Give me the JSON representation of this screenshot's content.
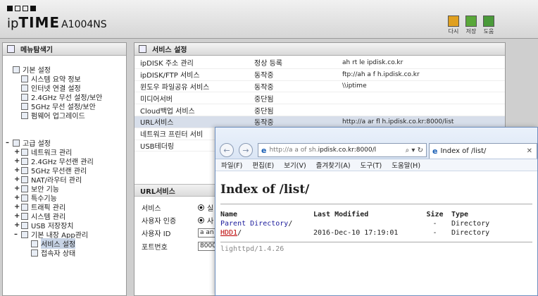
{
  "header": {
    "brand_ip": "ip",
    "brand_time": "TIME",
    "model": "A1004NS",
    "actions": [
      {
        "label": "다시",
        "color": "#e0a020"
      },
      {
        "label": "저장",
        "color": "#5aa83a"
      },
      {
        "label": "도움",
        "color": "#4a9a3a"
      }
    ]
  },
  "nav": {
    "title": "메뉴탐색기",
    "basic": {
      "label": "기본 설정",
      "items": [
        "시스템 요약 정보",
        "인터넷 연결 설정",
        "2.4GHz 무선 설정/보안",
        "5GHz 무선 설정/보안",
        "펌웨어 업그레이드"
      ]
    },
    "advanced": {
      "label": "고급 설정",
      "items": [
        "네트워크 관리",
        "2.4GHz 무선랜 관리",
        "5GHz 무선랜 관리",
        "NAT/라우터 관리",
        "보안 기능",
        "특수기능",
        "트래픽 관리",
        "시스템 관리",
        "USB 저장장치",
        "기본 내장 App관리"
      ],
      "subitems": [
        "서비스 설정",
        "접속자 상태"
      ]
    }
  },
  "main": {
    "title": "서비스 설정",
    "services": [
      {
        "name": "ipDISK 주소 관리",
        "status": "정상 등록",
        "detail": "ah   rt  le    ipdisk.co.kr"
      },
      {
        "name": "ipDISK/FTP 서비스",
        "status": "동작중",
        "detail": "ftp://ah  a  f    h.ipdisk.co.kr"
      },
      {
        "name": "윈도우 파일공유 서비스",
        "status": "동작중",
        "detail": "\\\\iptime"
      },
      {
        "name": "미디어서버",
        "status": "중단됨",
        "detail": ""
      },
      {
        "name": "Cloud백업 서비스",
        "status": "중단됨",
        "detail": ""
      },
      {
        "name": "URL서비스",
        "status": "동작중",
        "detail": "http://a   ar   fl   h.ipdisk.co.kr:8000/list"
      },
      {
        "name": "네트워크 프린터 서비",
        "status": "",
        "detail": ""
      },
      {
        "name": "USB테더링",
        "status": "",
        "detail": ""
      }
    ],
    "url_service": {
      "title": "URL서비스",
      "rows": [
        {
          "label": "서비스",
          "value": "실"
        },
        {
          "label": "사용자 인증",
          "value": "사"
        },
        {
          "label": "사용자 ID",
          "value": "a   an"
        },
        {
          "label": "포트번호",
          "value": "8000"
        }
      ]
    }
  },
  "browser": {
    "back": "←",
    "forward": "→",
    "address_prefix": "http://a   a   of   sh.",
    "address_main": "ipdisk.co.kr:8000/l",
    "address_tools": "⌕ ▾ ↻",
    "tab_label": "Index of /list/",
    "tab_close": "✕",
    "menu": [
      "파일(F)",
      "편집(E)",
      "보기(V)",
      "즐겨찾기(A)",
      "도구(T)",
      "도움말(H)"
    ],
    "page_title": "Index of /list/",
    "columns": [
      "Name",
      "Last Modified",
      "Size",
      "Type"
    ],
    "entries": [
      {
        "name": "Parent Directory",
        "suffix": "/",
        "modified": "",
        "size": "-",
        "type": "Directory"
      },
      {
        "name": "HDD1",
        "suffix": "/",
        "modified": "2016-Dec-10 17:19:01",
        "size": "-",
        "type": "Directory"
      }
    ],
    "footer": "lighttpd/1.4.26"
  }
}
